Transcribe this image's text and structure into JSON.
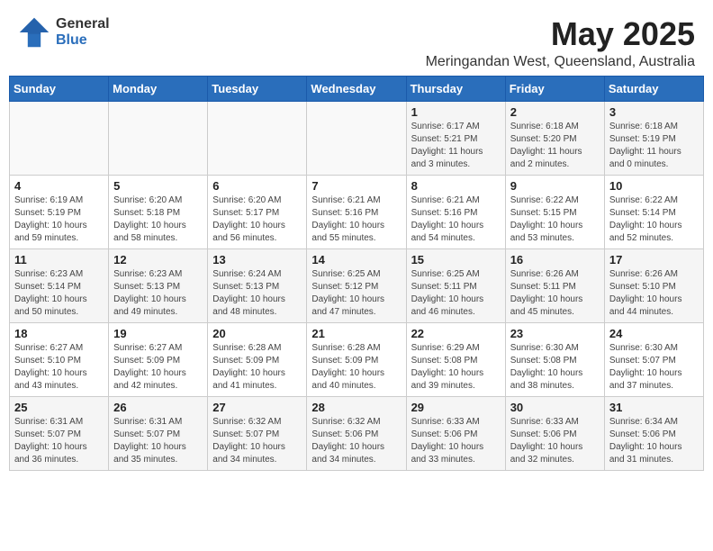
{
  "logo": {
    "general": "General",
    "blue": "Blue"
  },
  "header": {
    "month_year": "May 2025",
    "location": "Meringandan West, Queensland, Australia"
  },
  "weekdays": [
    "Sunday",
    "Monday",
    "Tuesday",
    "Wednesday",
    "Thursday",
    "Friday",
    "Saturday"
  ],
  "weeks": [
    [
      {
        "day": "",
        "info": ""
      },
      {
        "day": "",
        "info": ""
      },
      {
        "day": "",
        "info": ""
      },
      {
        "day": "",
        "info": ""
      },
      {
        "day": "1",
        "info": "Sunrise: 6:17 AM\nSunset: 5:21 PM\nDaylight: 11 hours\nand 3 minutes."
      },
      {
        "day": "2",
        "info": "Sunrise: 6:18 AM\nSunset: 5:20 PM\nDaylight: 11 hours\nand 2 minutes."
      },
      {
        "day": "3",
        "info": "Sunrise: 6:18 AM\nSunset: 5:19 PM\nDaylight: 11 hours\nand 0 minutes."
      }
    ],
    [
      {
        "day": "4",
        "info": "Sunrise: 6:19 AM\nSunset: 5:19 PM\nDaylight: 10 hours\nand 59 minutes."
      },
      {
        "day": "5",
        "info": "Sunrise: 6:20 AM\nSunset: 5:18 PM\nDaylight: 10 hours\nand 58 minutes."
      },
      {
        "day": "6",
        "info": "Sunrise: 6:20 AM\nSunset: 5:17 PM\nDaylight: 10 hours\nand 56 minutes."
      },
      {
        "day": "7",
        "info": "Sunrise: 6:21 AM\nSunset: 5:16 PM\nDaylight: 10 hours\nand 55 minutes."
      },
      {
        "day": "8",
        "info": "Sunrise: 6:21 AM\nSunset: 5:16 PM\nDaylight: 10 hours\nand 54 minutes."
      },
      {
        "day": "9",
        "info": "Sunrise: 6:22 AM\nSunset: 5:15 PM\nDaylight: 10 hours\nand 53 minutes."
      },
      {
        "day": "10",
        "info": "Sunrise: 6:22 AM\nSunset: 5:14 PM\nDaylight: 10 hours\nand 52 minutes."
      }
    ],
    [
      {
        "day": "11",
        "info": "Sunrise: 6:23 AM\nSunset: 5:14 PM\nDaylight: 10 hours\nand 50 minutes."
      },
      {
        "day": "12",
        "info": "Sunrise: 6:23 AM\nSunset: 5:13 PM\nDaylight: 10 hours\nand 49 minutes."
      },
      {
        "day": "13",
        "info": "Sunrise: 6:24 AM\nSunset: 5:13 PM\nDaylight: 10 hours\nand 48 minutes."
      },
      {
        "day": "14",
        "info": "Sunrise: 6:25 AM\nSunset: 5:12 PM\nDaylight: 10 hours\nand 47 minutes."
      },
      {
        "day": "15",
        "info": "Sunrise: 6:25 AM\nSunset: 5:11 PM\nDaylight: 10 hours\nand 46 minutes."
      },
      {
        "day": "16",
        "info": "Sunrise: 6:26 AM\nSunset: 5:11 PM\nDaylight: 10 hours\nand 45 minutes."
      },
      {
        "day": "17",
        "info": "Sunrise: 6:26 AM\nSunset: 5:10 PM\nDaylight: 10 hours\nand 44 minutes."
      }
    ],
    [
      {
        "day": "18",
        "info": "Sunrise: 6:27 AM\nSunset: 5:10 PM\nDaylight: 10 hours\nand 43 minutes."
      },
      {
        "day": "19",
        "info": "Sunrise: 6:27 AM\nSunset: 5:09 PM\nDaylight: 10 hours\nand 42 minutes."
      },
      {
        "day": "20",
        "info": "Sunrise: 6:28 AM\nSunset: 5:09 PM\nDaylight: 10 hours\nand 41 minutes."
      },
      {
        "day": "21",
        "info": "Sunrise: 6:28 AM\nSunset: 5:09 PM\nDaylight: 10 hours\nand 40 minutes."
      },
      {
        "day": "22",
        "info": "Sunrise: 6:29 AM\nSunset: 5:08 PM\nDaylight: 10 hours\nand 39 minutes."
      },
      {
        "day": "23",
        "info": "Sunrise: 6:30 AM\nSunset: 5:08 PM\nDaylight: 10 hours\nand 38 minutes."
      },
      {
        "day": "24",
        "info": "Sunrise: 6:30 AM\nSunset: 5:07 PM\nDaylight: 10 hours\nand 37 minutes."
      }
    ],
    [
      {
        "day": "25",
        "info": "Sunrise: 6:31 AM\nSunset: 5:07 PM\nDaylight: 10 hours\nand 36 minutes."
      },
      {
        "day": "26",
        "info": "Sunrise: 6:31 AM\nSunset: 5:07 PM\nDaylight: 10 hours\nand 35 minutes."
      },
      {
        "day": "27",
        "info": "Sunrise: 6:32 AM\nSunset: 5:07 PM\nDaylight: 10 hours\nand 34 minutes."
      },
      {
        "day": "28",
        "info": "Sunrise: 6:32 AM\nSunset: 5:06 PM\nDaylight: 10 hours\nand 34 minutes."
      },
      {
        "day": "29",
        "info": "Sunrise: 6:33 AM\nSunset: 5:06 PM\nDaylight: 10 hours\nand 33 minutes."
      },
      {
        "day": "30",
        "info": "Sunrise: 6:33 AM\nSunset: 5:06 PM\nDaylight: 10 hours\nand 32 minutes."
      },
      {
        "day": "31",
        "info": "Sunrise: 6:34 AM\nSunset: 5:06 PM\nDaylight: 10 hours\nand 31 minutes."
      }
    ]
  ]
}
